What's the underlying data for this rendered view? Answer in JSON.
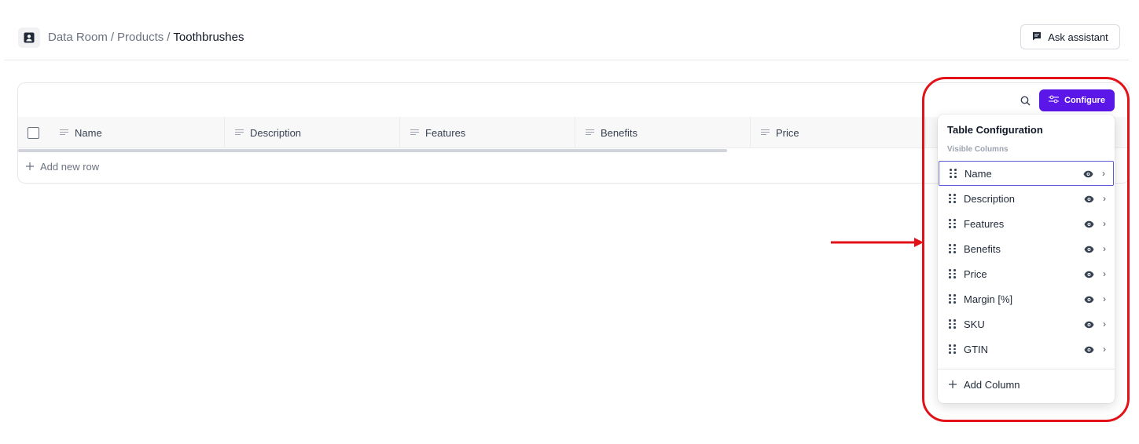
{
  "breadcrumb": {
    "part1": "Data Room",
    "sep": "/",
    "part2": "Products",
    "current": "Toothbrushes"
  },
  "header": {
    "ask_label": "Ask assistant"
  },
  "toolbar": {
    "configure_label": "Configure"
  },
  "table": {
    "columns": [
      "Name",
      "Description",
      "Features",
      "Benefits",
      "Price"
    ],
    "add_row_label": "Add new row"
  },
  "config": {
    "title": "Table Configuration",
    "section": "Visible Columns",
    "items": [
      "Name",
      "Description",
      "Features",
      "Benefits",
      "Price",
      "Margin [%]",
      "SKU",
      "GTIN"
    ],
    "add_column_label": "Add Column"
  },
  "colors": {
    "accent": "#5b16e8",
    "annotation": "#e21218"
  }
}
